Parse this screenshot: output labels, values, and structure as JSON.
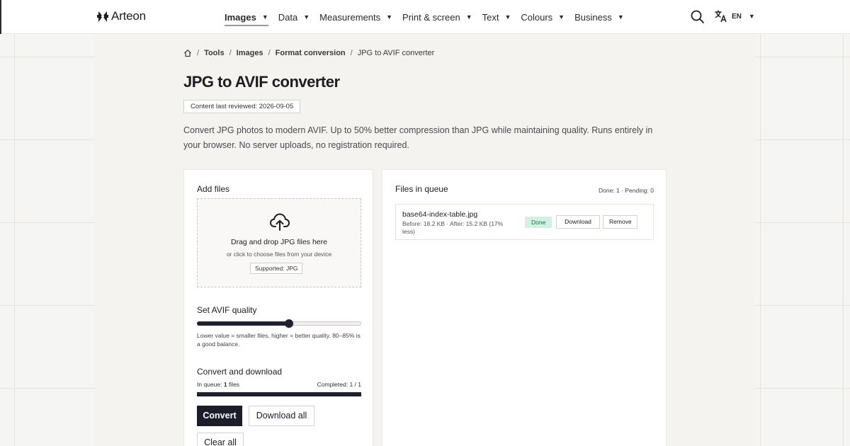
{
  "header": {
    "brand": "Arteon",
    "nav": [
      {
        "label": "Images",
        "active": true
      },
      {
        "label": "Data",
        "active": false
      },
      {
        "label": "Measurements",
        "active": false
      },
      {
        "label": "Print & screen",
        "active": false
      },
      {
        "label": "Text",
        "active": false
      },
      {
        "label": "Colours",
        "active": false
      },
      {
        "label": "Business",
        "active": false
      }
    ],
    "language": "EN",
    "caret": "▼"
  },
  "breadcrumb": {
    "items": [
      "Tools",
      "Images",
      "Format conversion"
    ],
    "current": "JPG to AVIF converter",
    "separator": "/"
  },
  "page": {
    "title": "JPG to AVIF converter",
    "reviewed": "Content last reviewed: 2026-09-05",
    "intro": "Convert JPG photos to modern AVIF. Up to 50% better compression than JPG while maintaining quality. Runs entirely in your browser. No server uploads, no registration required."
  },
  "add_files": {
    "title": "Add files",
    "drop_main": "Drag and drop JPG files here",
    "drop_sub": "or click to choose files from your device",
    "supported": "Supported: JPG"
  },
  "quality": {
    "title": "Set AVIF quality",
    "value_fraction": 0.56,
    "hint": "Lower value = smaller files, higher = better quality. 80–85% is a good balance."
  },
  "convert": {
    "title": "Convert and download",
    "in_queue_label": "In queue:",
    "in_queue_count": "1",
    "in_queue_unit": "files",
    "completed": "Completed: 1 / 1",
    "progress_fraction": 1.0,
    "convert_label": "Convert",
    "download_all_label": "Download all",
    "clear_all_label": "Clear all"
  },
  "queue": {
    "title": "Files in queue",
    "counts": "Done: 1 · Pending: 0",
    "files": [
      {
        "name": "base64-index-table.jpg",
        "meta": "Before: 18.2 KB · After: 15.2 KB (17% less)",
        "status": "Done",
        "download_label": "Download",
        "remove_label": "Remove"
      }
    ]
  },
  "colors": {
    "accent": "#1c1d2a",
    "done_badge_bg": "#d2f1e2",
    "done_badge_text": "#1e6d47",
    "panel_bg": "#f5f3ef"
  },
  "icons": [
    "brand-logo-icon",
    "search-icon",
    "translate-icon",
    "home-icon",
    "cloud-upload-icon"
  ]
}
